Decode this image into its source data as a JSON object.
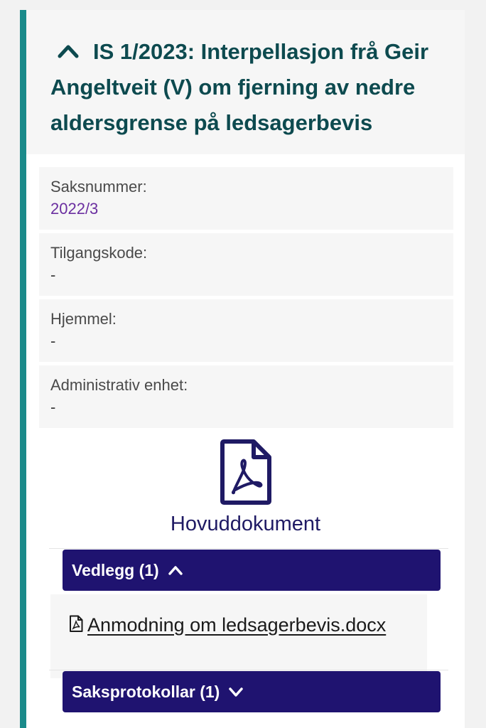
{
  "case": {
    "title": "IS 1/2023: Interpellasjon frå Geir Angeltveit (V) om fjerning av nedre aldersgrense på ledsagerbevis"
  },
  "meta": [
    {
      "label": "Saksnummer:",
      "value": "2022/3"
    },
    {
      "label": "Tilgangskode:",
      "value": "-"
    },
    {
      "label": "Hjemmel:",
      "value": "-"
    },
    {
      "label": "Administrativ enhet:",
      "value": "-"
    }
  ],
  "main_document": {
    "label": "Hovuddokument",
    "icon": "pdf-file-icon"
  },
  "attachments": {
    "label": "Vedlegg (1)",
    "expanded": true,
    "items": [
      {
        "name": "Anmodning om ledsagerbevis.docx",
        "icon": "pdf-file-icon"
      }
    ]
  },
  "protocols": {
    "label": "Saksprotokollar (1)",
    "expanded": false
  },
  "colors": {
    "accent_border": "#1a8a8a",
    "title_text": "#0d4a4f",
    "link_purple": "#6b2fa0",
    "button_navy": "#1f1370"
  }
}
